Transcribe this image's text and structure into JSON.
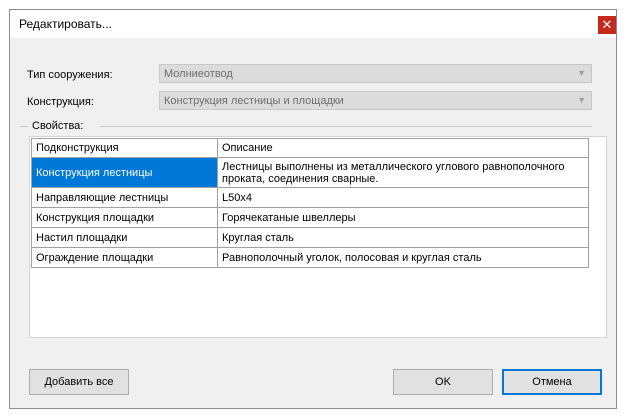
{
  "window": {
    "title": "Редактировать...",
    "close_glyph": "✕"
  },
  "form": {
    "structure_type_label": "Тип сооружения:",
    "structure_type_value": "Молниеотвод",
    "construction_label": "Конструкция:",
    "construction_value": "Конструкция лестницы и площадки",
    "properties_group": "Свойства:"
  },
  "table": {
    "columns": [
      "Подконструкция",
      "Описание"
    ],
    "rows": [
      {
        "name": "Конструкция лестницы",
        "desc": "Лестницы выполнены из металлического углового равнополочного проката, соединения сварные."
      },
      {
        "name": "Направляющие лестницы",
        "desc": "L50x4"
      },
      {
        "name": "Конструкция площадки",
        "desc": "Горячекатаные швеллеры"
      },
      {
        "name": "Настил площадки",
        "desc": "Круглая сталь"
      },
      {
        "name": "Ограждение площадки",
        "desc": "Равнополочный уголок, полосовая и круглая сталь"
      }
    ]
  },
  "buttons": {
    "add_all": "Добавить все",
    "ok": "OK",
    "cancel": "Отмена"
  },
  "colors": {
    "selection": "#0078d7",
    "close": "#c42b1c"
  }
}
